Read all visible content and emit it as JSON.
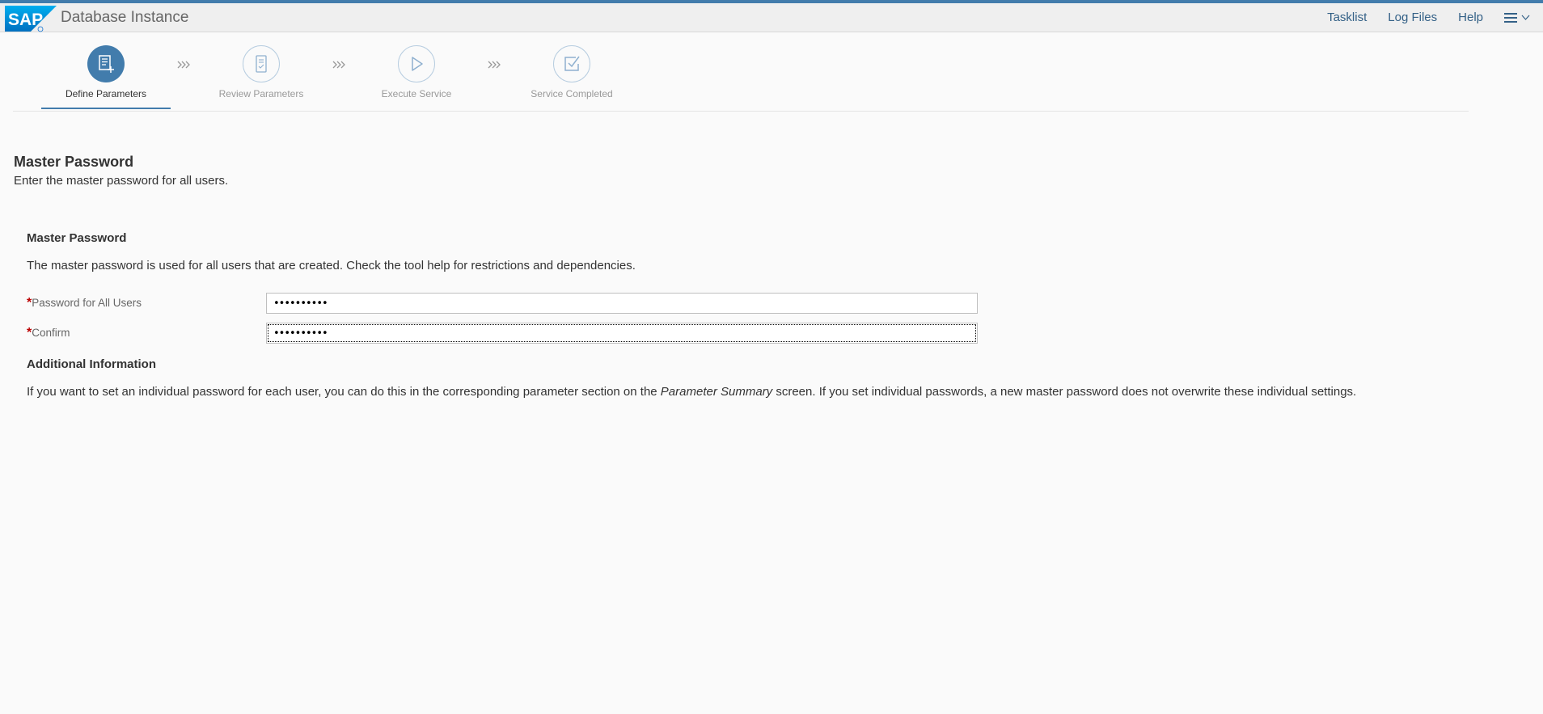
{
  "colors": {
    "accent": "#427cac",
    "link": "#346187",
    "required": "#bb0000"
  },
  "shell": {
    "logo_text": "SAP",
    "app_title": "Database Instance",
    "links": [
      "Tasklist",
      "Log Files",
      "Help"
    ],
    "menu_icon": "hamburger-icon"
  },
  "wizard": {
    "steps": [
      {
        "label": "Define Parameters",
        "icon": "form-add-icon",
        "state": "active"
      },
      {
        "label": "Review Parameters",
        "icon": "checklist-document-icon",
        "state": "inactive"
      },
      {
        "label": "Execute Service",
        "icon": "play-icon",
        "state": "inactive"
      },
      {
        "label": "Service Completed",
        "icon": "checkbox-icon",
        "state": "inactive"
      }
    ],
    "separator_icon": "triple-chevron-icon"
  },
  "page": {
    "heading": "Master Password",
    "subheading": "Enter the master password for all users."
  },
  "section": {
    "title": "Master Password",
    "description": "The master password is used for all users that are created. Check the tool help for restrictions and dependencies.",
    "fields": [
      {
        "label": "Password for All Users",
        "required": "*",
        "value": "••••••••••"
      },
      {
        "label": "Confirm",
        "required": "*",
        "value": "••••••••••"
      }
    ]
  },
  "additional": {
    "title": "Additional Information",
    "text_before": "If you want to set an individual password for each user, you can do this in the corresponding parameter section on the ",
    "text_italic": "Parameter Summary",
    "text_after": " screen. If you set individual passwords, a new master password does not overwrite these individual settings."
  }
}
